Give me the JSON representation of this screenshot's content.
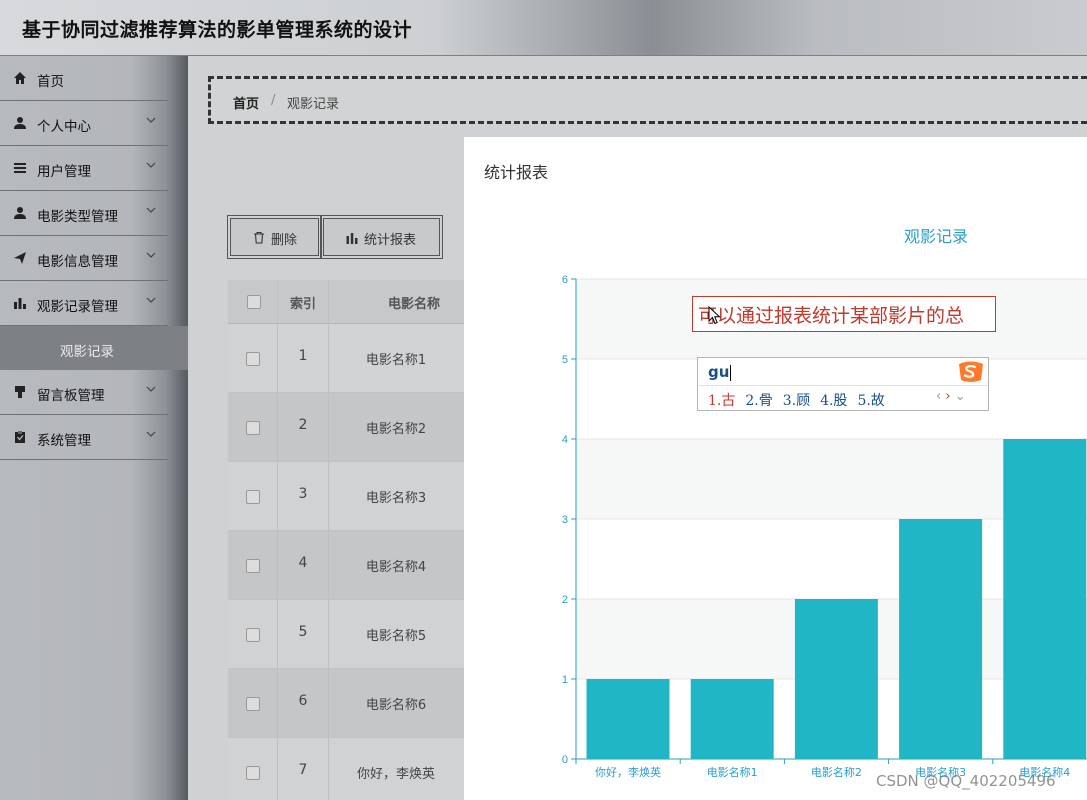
{
  "app": {
    "title": "基于协同过滤推荐算法的影单管理系统的设计"
  },
  "sidebar": {
    "items": [
      {
        "label": "首页",
        "icon": "home-icon"
      },
      {
        "label": "个人中心",
        "icon": "user-icon"
      },
      {
        "label": "用户管理",
        "icon": "list-icon"
      },
      {
        "label": "电影类型管理",
        "icon": "user-icon"
      },
      {
        "label": "电影信息管理",
        "icon": "send-icon"
      },
      {
        "label": "观影记录管理",
        "icon": "bar-chart-icon"
      },
      {
        "label": "留言板管理",
        "icon": "message-icon"
      },
      {
        "label": "系统管理",
        "icon": "clipboard-icon"
      }
    ],
    "submenu_label": "观影记录"
  },
  "breadcrumb": {
    "home": "首页",
    "separator": "/",
    "current": "观影记录"
  },
  "toolbar": {
    "delete_label": "删除",
    "report_label": "统计报表"
  },
  "table": {
    "headers": {
      "index": "索引",
      "name": "电影名称"
    },
    "rows": [
      {
        "index": "1",
        "name": "电影名称1"
      },
      {
        "index": "2",
        "name": "电影名称2"
      },
      {
        "index": "3",
        "name": "电影名称3"
      },
      {
        "index": "4",
        "name": "电影名称4"
      },
      {
        "index": "5",
        "name": "电影名称5"
      },
      {
        "index": "6",
        "name": "电影名称6"
      },
      {
        "index": "7",
        "name": "你好，李焕英"
      }
    ]
  },
  "modal": {
    "title": "统计报表"
  },
  "annotation": {
    "text": "可以通过报表统计某部影片的总"
  },
  "ime": {
    "input": "gu",
    "candidates": [
      "1.古",
      "2.骨",
      "3.顾",
      "4.股",
      "5.故"
    ]
  },
  "watermark": {
    "text": "CSDN @QQ_402205496"
  },
  "colors": {
    "bar": "#21b6c6",
    "chart_title": "#2b9ec9",
    "axis": "#2b9ec9"
  },
  "chart_data": {
    "type": "bar",
    "title": "观影记录",
    "categories": [
      "你好，李焕英",
      "电影名称1",
      "电影名称2",
      "电影名称3",
      "电影名称4"
    ],
    "values": [
      1,
      1,
      2,
      3,
      4
    ],
    "ylim": [
      0,
      6
    ],
    "yticks": [
      0,
      1,
      2,
      3,
      4,
      5,
      6
    ],
    "grid": true,
    "xlabel": "",
    "ylabel": ""
  }
}
